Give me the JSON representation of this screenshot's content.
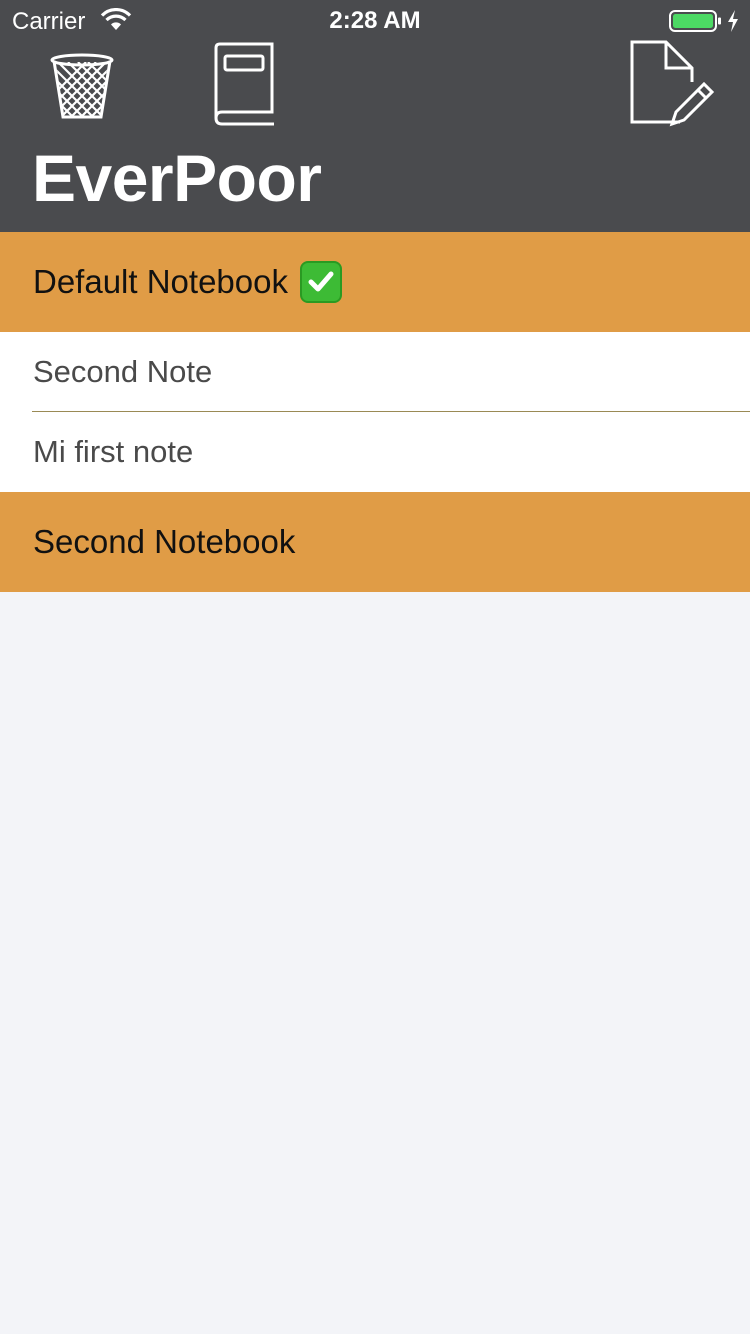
{
  "status_bar": {
    "carrier": "Carrier",
    "time": "2:28 AM"
  },
  "nav": {
    "title": "EverPoor",
    "left_icons": [
      "trash-icon",
      "notebook-icon"
    ],
    "right_icon": "compose-icon"
  },
  "notebooks": [
    {
      "name": "Default Notebook",
      "is_default": true,
      "notes": [
        "Second Note",
        "Mi first note"
      ]
    },
    {
      "name": "Second Notebook",
      "is_default": false,
      "notes": []
    }
  ],
  "colors": {
    "nav_background": "#4a4b4e",
    "section_header": "#e09c46",
    "list_background": "#f3f4f8",
    "battery_green": "#4cd964",
    "check_green": "#3dbb35"
  }
}
